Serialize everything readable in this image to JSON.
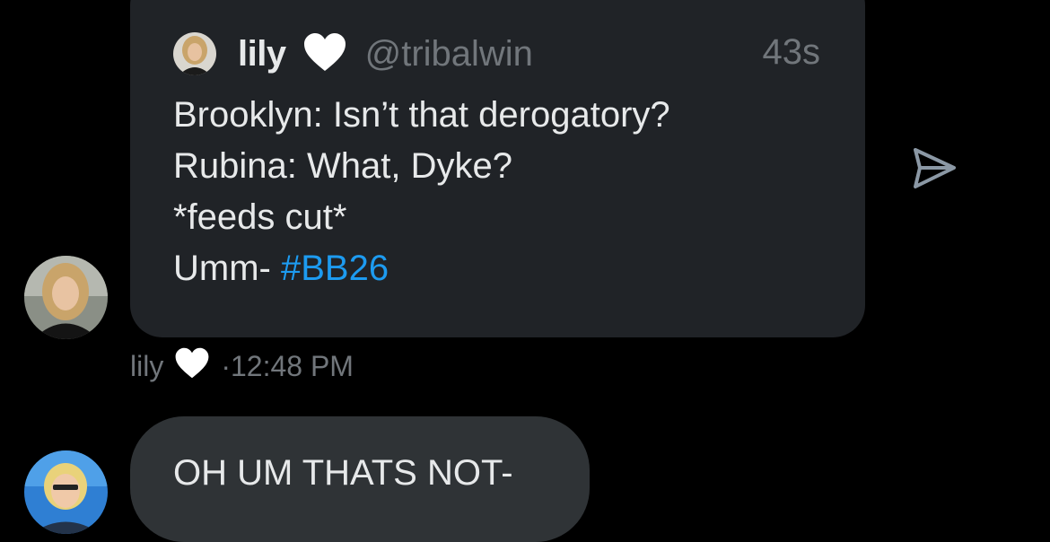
{
  "quoted_tweet": {
    "author_name": "lily",
    "handle": "@tribalwin",
    "time_ago": "43s",
    "lines": [
      "Brooklyn: Isn’t that derogatory?",
      "Rubina: What, Dyke?",
      "*feeds cut*",
      "Umm- "
    ],
    "hashtag": "#BB26"
  },
  "message_meta": {
    "sender": "lily",
    "separator": "·",
    "time": "12:48 PM"
  },
  "reply": {
    "text": "OH UM THATS NOT-"
  },
  "icons": {
    "heart": "white-heart-icon",
    "share": "send-arrow-icon"
  },
  "colors": {
    "background": "#000000",
    "card": "#202327",
    "bubble": "#2f3336",
    "text": "#e7e9ea",
    "muted": "#71767b",
    "link": "#1d9bf0"
  }
}
